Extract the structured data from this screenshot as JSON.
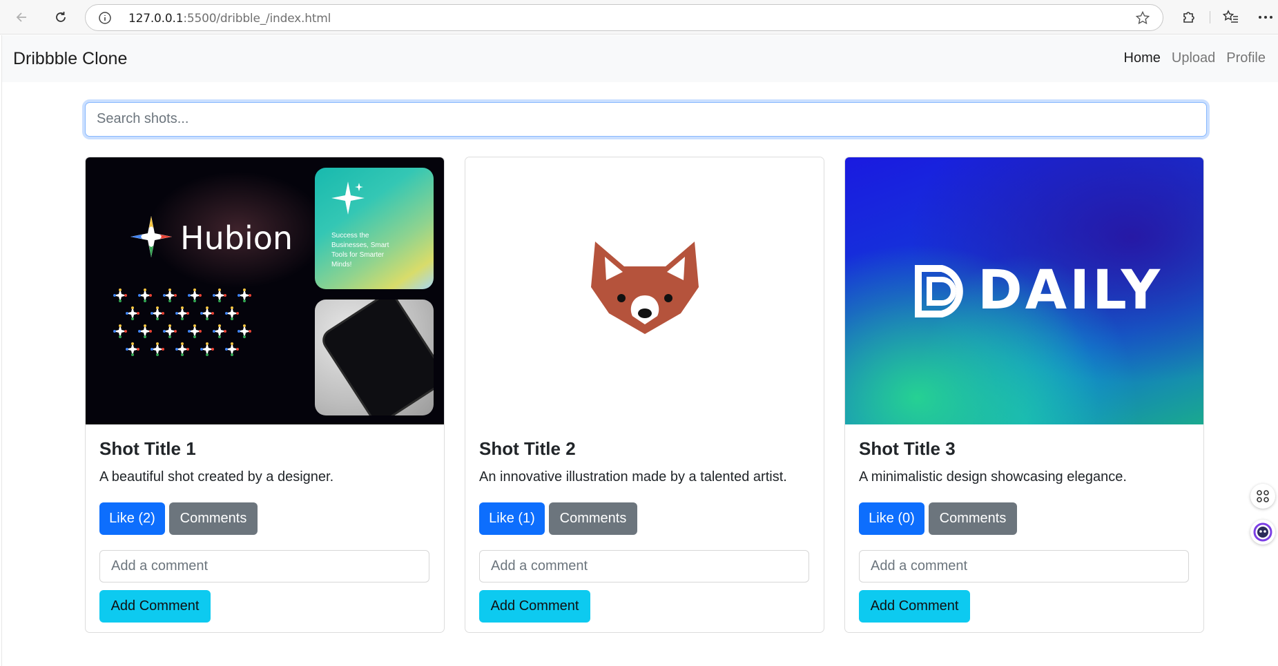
{
  "browser": {
    "url_host": "127.0.0.1",
    "url_path": ":5500/dribble_/index.html"
  },
  "navbar": {
    "brand": "Dribbble Clone",
    "links": [
      {
        "label": "Home",
        "active": true
      },
      {
        "label": "Upload",
        "active": false
      },
      {
        "label": "Profile",
        "active": false
      }
    ]
  },
  "search": {
    "placeholder": "Search shots..."
  },
  "shots": [
    {
      "title": "Shot Title 1",
      "description": "A beautiful shot created by a designer.",
      "like_label": "Like (2)",
      "comments_label": "Comments",
      "comment_placeholder": "Add a comment",
      "add_comment_label": "Add Comment",
      "image": {
        "brand_text": "Hubion",
        "card_text": "Success the Businesses, Smart Tools for Smarter Minds!"
      }
    },
    {
      "title": "Shot Title 2",
      "description": "An innovative illustration made by a talented artist.",
      "like_label": "Like (1)",
      "comments_label": "Comments",
      "comment_placeholder": "Add a comment",
      "add_comment_label": "Add Comment",
      "image": {
        "icon": "fox-logo-icon"
      }
    },
    {
      "title": "Shot Title 3",
      "description": "A minimalistic design showcasing elegance.",
      "like_label": "Like (0)",
      "comments_label": "Comments",
      "comment_placeholder": "Add a comment",
      "add_comment_label": "Add Comment",
      "image": {
        "brand_text": "DAILY"
      }
    }
  ],
  "colors": {
    "primary": "#0d6efd",
    "secondary": "#6c757d",
    "info": "#0dcaf0"
  }
}
